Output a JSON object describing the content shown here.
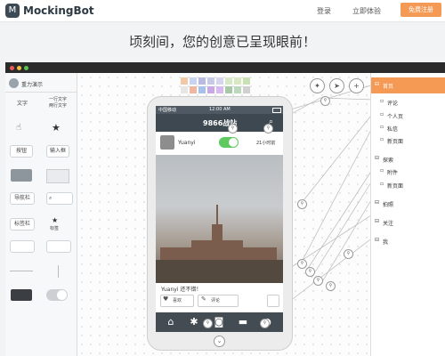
{
  "nav": {
    "brand": "MockingBot",
    "login": "登录",
    "try": "立即体验",
    "cta": "免费注册"
  },
  "tagline": "顷刻间，您的创意已呈现眼前！",
  "left_panel": {
    "header": "重力演示",
    "widgets": [
      "文字",
      "一行文字\n两行文字",
      "按钮",
      "输入框",
      "导航栏",
      "标签栏",
      "标签"
    ]
  },
  "colors": {
    "accent": "#f49a55",
    "toggle_on": "#5ec95e",
    "swatches": [
      "#f3c9a5",
      "#c9d4f0",
      "#b9b9e6",
      "#c8c8e8",
      "#d5d5f0",
      "#d6e8c8",
      "#d8e8c0",
      "#c9e0b3",
      "#e6e6e6",
      "#f0b6a0",
      "#a8c0ec",
      "#c9a8e6",
      "#d8b8f0",
      "#a8c8a8",
      "#bcd8bc",
      "#d0d0d0"
    ]
  },
  "toolbar": {
    "icons": [
      "lightbulb-icon",
      "paper-plane-icon",
      "plus-icon"
    ]
  },
  "phone": {
    "status_carrier": "中国移动",
    "status_time": "12:00 AM",
    "app_title": "9866战站",
    "username": "Yuanyi",
    "time_ago": "21小时前",
    "caption": "Yuanyi  还不错！",
    "like_label": "喜欢",
    "comment_label": "评论",
    "tabs": [
      "home-icon",
      "asterisk-icon",
      "camera-icon",
      "chat-icon",
      "profile-icon"
    ]
  },
  "right_panel": {
    "pages": [
      {
        "label": "首页",
        "group": true,
        "active": true
      },
      {
        "label": "评论",
        "group": false
      },
      {
        "label": "个人页",
        "group": false
      },
      {
        "label": "私信",
        "group": false
      },
      {
        "label": "新页面",
        "group": false
      },
      {
        "label": "探索",
        "group": true
      },
      {
        "label": "附件",
        "group": false
      },
      {
        "label": "新页面",
        "group": false
      },
      {
        "label": "拍照",
        "group": true
      },
      {
        "label": "关注",
        "group": true
      },
      {
        "label": "我",
        "group": true
      }
    ]
  }
}
